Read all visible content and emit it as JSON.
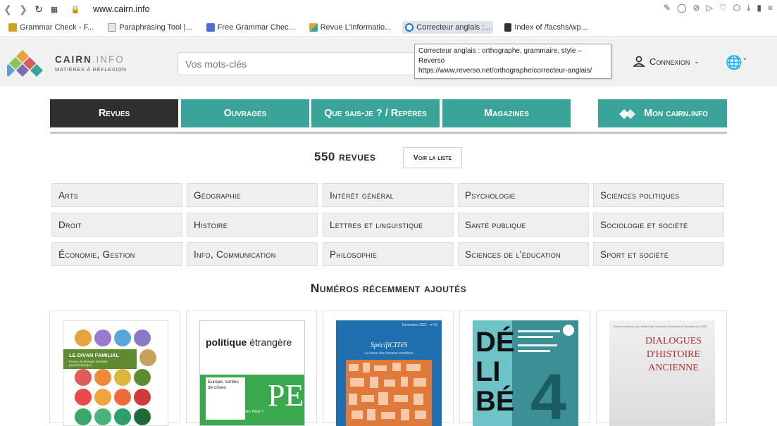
{
  "browser": {
    "url": "www.cairn.info",
    "bookmarks": [
      {
        "label": "Grammar Check - F..."
      },
      {
        "label": "Paraphrasing Tool |..."
      },
      {
        "label": "Free Grammar Chec..."
      },
      {
        "label": "Revue L'informatio..."
      },
      {
        "label": "Correcteur anglais :..."
      },
      {
        "label": "Index of /facshs/wp..."
      }
    ],
    "tooltip": {
      "title": "Correcteur anglais : orthographe, grammaire, style – Reverso",
      "url": "https://www.reverso.net/orthographe/correcteur-anglais/"
    }
  },
  "header": {
    "logo_name_a": "CAIRN",
    "logo_name_b": ".INFO",
    "logo_tag": "MATIÈRES À RÉFLEXION",
    "search_placeholder": "Vos mots-clés",
    "connexion_label": "Connexion"
  },
  "tabs": [
    {
      "label": "Revues"
    },
    {
      "label": "Ouvrages"
    },
    {
      "label": "Que sais-je ? / Repères"
    },
    {
      "label": "Magazines"
    },
    {
      "label": "Mon cairn.info"
    }
  ],
  "revues": {
    "count_label": "550 revues",
    "list_button": "Voir la liste"
  },
  "disciplines": [
    [
      "Arts",
      "Géographie",
      "Intérêt général",
      "Psychologie",
      "Sciences politiques"
    ],
    [
      "Droit",
      "Histoire",
      "Lettres et linguistique",
      "Santé publique",
      "Sociologie et société"
    ],
    [
      "Économie, Gestion",
      "Info, Communication",
      "Philosophie",
      "Sciences de l'éducation",
      "Sport et société"
    ]
  ],
  "recent": {
    "title": "Numéros récemment ajoutés",
    "covers": [
      {
        "title": "LE DIVAN FAMILIAL",
        "subtitle": "Revue de thérapie familiale psychanalytique"
      },
      {
        "title_a": "politique",
        "title_b": "étrangère",
        "subtitle": "Europe, sorties de crises",
        "footer": "Sahel : les sociétés contre l'État ?",
        "mark": "PE"
      },
      {
        "title": "SpécifiCITéS",
        "subtitle": "La revue des terrains sensibles",
        "meta": "Décembre 2021 · n°16"
      },
      {
        "title_a": "DÉ",
        "title_b": "LI",
        "title_c": "BÉ",
        "number": "4"
      },
      {
        "title": "DIALOGUES D'HISTOIRE ANCIENNE",
        "meta": "Revue soutenue par l'Institut des Sciences Humaines et Sociales du CNRS"
      }
    ]
  },
  "colors": {
    "teal": "#3aa39a",
    "dark": "#2f2f2f",
    "header_bg": "#f1f1f1"
  }
}
